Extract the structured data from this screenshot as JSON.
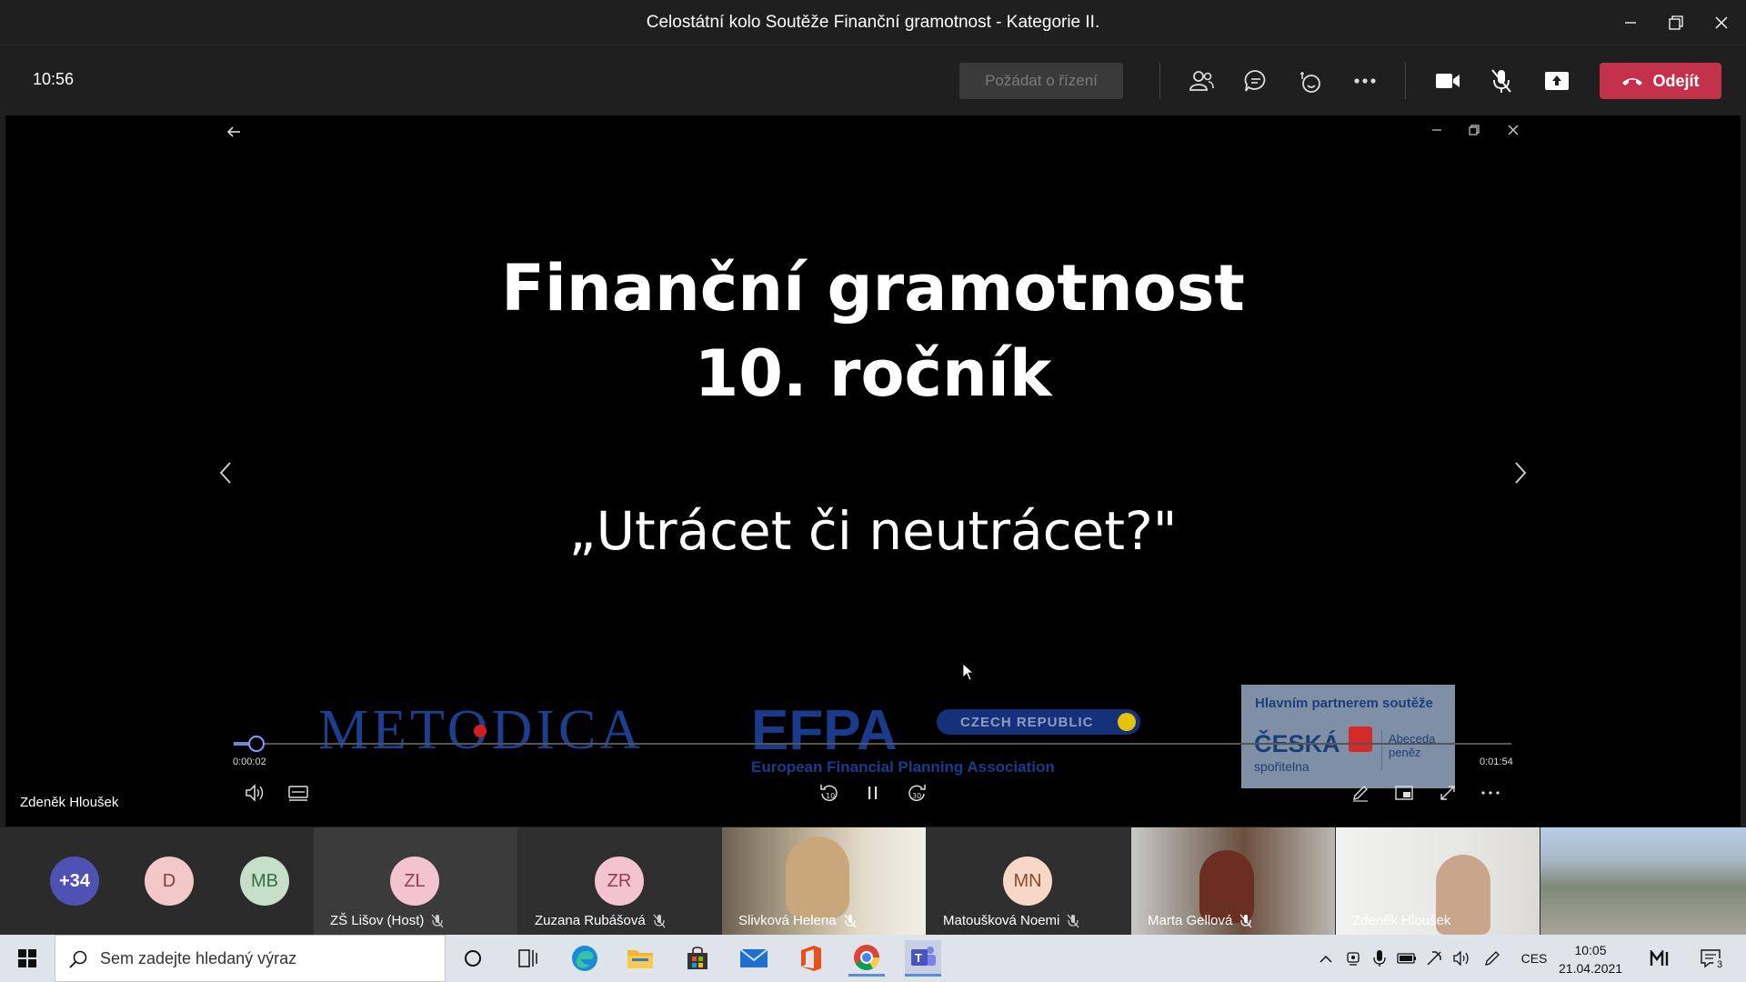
{
  "window": {
    "title": "Celostátní kolo Soutěže Finanční gramotnost - Kategorie II."
  },
  "toolbar": {
    "clock": "10:56",
    "request_control": "Požádat o řízení",
    "leave_label": "Odejít"
  },
  "slide": {
    "title_line1": "Finanční gramotnost",
    "title_line2": "10. ročník",
    "subtitle": "„Utrácet či neutrácet?\"",
    "logo_metodica": "METODICA",
    "logo_efpa": "EFPA",
    "logo_efpa_country": "CZECH REPUBLIC",
    "logo_efpa_full": "European Financial Planning Association",
    "partner_heading": "Hlavním partnerem soutěže",
    "partner_bank": "ČESKÁ",
    "partner_bank2": "spořitelna",
    "partner_side1": "Abeceda",
    "partner_side2": "peněz"
  },
  "player": {
    "time_current": "0:00:02",
    "time_total": "0:01:54",
    "progress": 0.018
  },
  "presenter": {
    "name": "Zdeněk Hloušek"
  },
  "participants": {
    "overflow": "+34",
    "avatar_d": "D",
    "avatar_mb": "MB",
    "tiles": [
      {
        "initials": "ZL",
        "name": "ZŠ Lišov (Host)"
      },
      {
        "initials": "ZR",
        "name": "Zuzana Rubášová"
      },
      {
        "initials": "",
        "name": "Slivková Helena"
      },
      {
        "initials": "MN",
        "name": "Matoušková Noemi"
      },
      {
        "initials": "",
        "name": "Marta Gellová"
      },
      {
        "initials": "",
        "name": "Zdeněk Hloušek"
      }
    ]
  },
  "taskbar": {
    "search_placeholder": "Sem zadejte hledaný výraz",
    "lang": "CES",
    "time": "10:05",
    "date": "21.04.2021",
    "notifications": "3"
  },
  "colors": {
    "leave": "#c4314b",
    "accent": "#6264a7"
  }
}
